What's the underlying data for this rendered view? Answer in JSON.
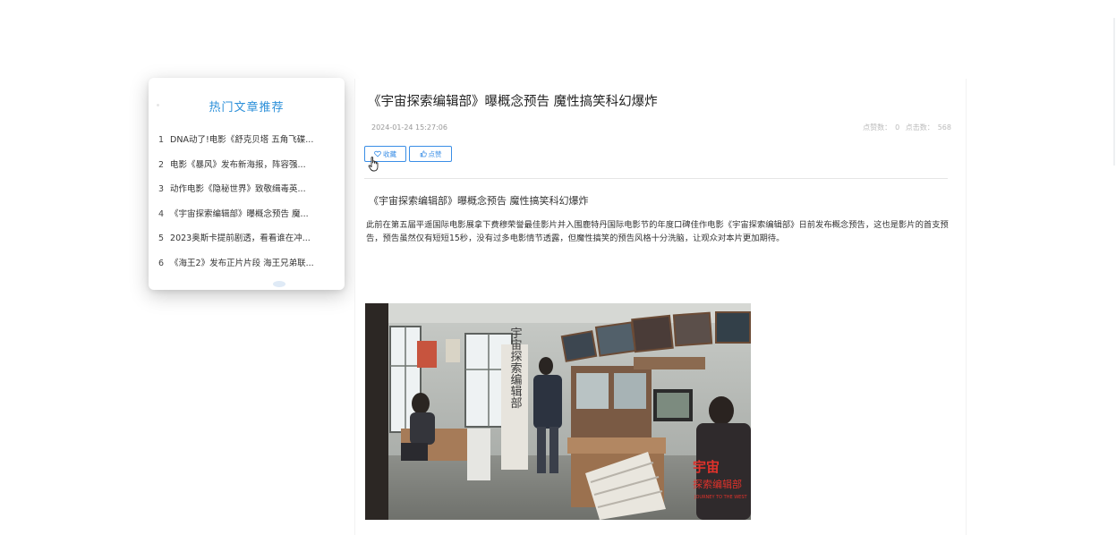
{
  "sidebar": {
    "title": "热门文章推荐",
    "items": [
      {
        "num": "1",
        "title": "DNA动了!电影《舒克贝塔 五角飞碟..."
      },
      {
        "num": "2",
        "title": "电影《暴风》发布新海报，阵容强..."
      },
      {
        "num": "3",
        "title": "动作电影《隐秘世界》致敬缉毒英..."
      },
      {
        "num": "4",
        "title": "《宇宙探索编辑部》曝概念预告 魔..."
      },
      {
        "num": "5",
        "title": "2023奥斯卡提前剧透，看看谁在冲..."
      },
      {
        "num": "6",
        "title": "《海王2》发布正片片段 海王兄弟联..."
      }
    ]
  },
  "article": {
    "title": "《宇宙探索编辑部》曝概念预告 魔性搞笑科幻爆炸",
    "datetime": "2024-01-24 15:27:06",
    "likes_label": "点赞数：",
    "likes_value": "0",
    "clicks_label": "点击数：",
    "clicks_value": "568",
    "favorite_label": "收藏",
    "like_label": "点赞",
    "subtitle": "《宇宙探索编辑部》曝概念预告 魔性搞笑科幻爆炸",
    "body": "此前在第五届平遥国际电影展拿下费穆荣誉最佳影片并入围鹿特丹国际电影节的年度口碑佳作电影《宇宙探索编辑部》日前发布概念预告，这也是影片的首支预告，预告虽然仅有短短15秒，没有过多电影情节透露，但魔性搞笑的预告风格十分洗脑，让观众对本片更加期待。",
    "image": {
      "banner_text": "宇宙探索编辑部",
      "logo_text": "宇宙探索编辑部",
      "logo_english": "JOURNEY TO THE WEST"
    }
  },
  "colors": {
    "accent": "#3a8ee6",
    "title_blue": "#2b8fd9",
    "logo_red": "#e0322b"
  }
}
